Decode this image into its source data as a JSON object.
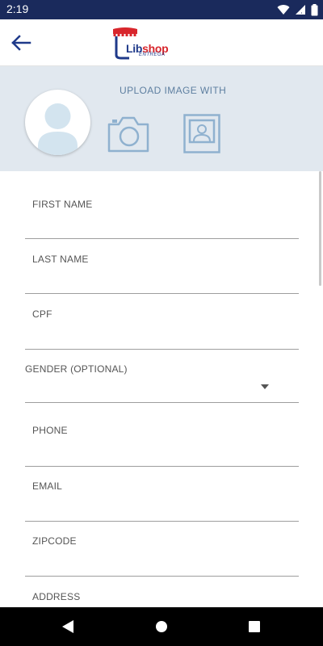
{
  "status_bar": {
    "time": "2:19",
    "icons": [
      "wifi-icon",
      "signal-icon",
      "battery-icon"
    ]
  },
  "app_bar": {
    "back_icon": "arrow-left-icon",
    "logo": {
      "brand_prefix": "Lib",
      "brand_suffix": "shop",
      "tagline": "ENTREGA"
    }
  },
  "upload": {
    "title": "UPLOAD IMAGE WITH",
    "options": [
      "camera-icon",
      "gallery-icon"
    ]
  },
  "form": {
    "fields": {
      "first_name": {
        "label": "FIRST NAME",
        "value": ""
      },
      "last_name": {
        "label": "LAST NAME",
        "value": ""
      },
      "cpf": {
        "label": "CPF",
        "value": ""
      },
      "gender": {
        "label": "GENDER (OPTIONAL)",
        "value": ""
      },
      "phone": {
        "label": "PHONE",
        "value": ""
      },
      "email": {
        "label": "EMAIL",
        "value": ""
      },
      "zipcode": {
        "label": "ZIPCODE",
        "value": ""
      },
      "address": {
        "label": "ADDRESS",
        "value": ""
      }
    }
  },
  "nav_bar": {
    "buttons": [
      "nav-back-icon",
      "nav-home-icon",
      "nav-recents-icon"
    ]
  },
  "colors": {
    "status_bar": "#1a2a5c",
    "upload_panel": "#e1e8ef",
    "accent_icon": "#8fb1cf",
    "brand_blue": "#1f3a8a",
    "brand_red": "#d8262c"
  }
}
